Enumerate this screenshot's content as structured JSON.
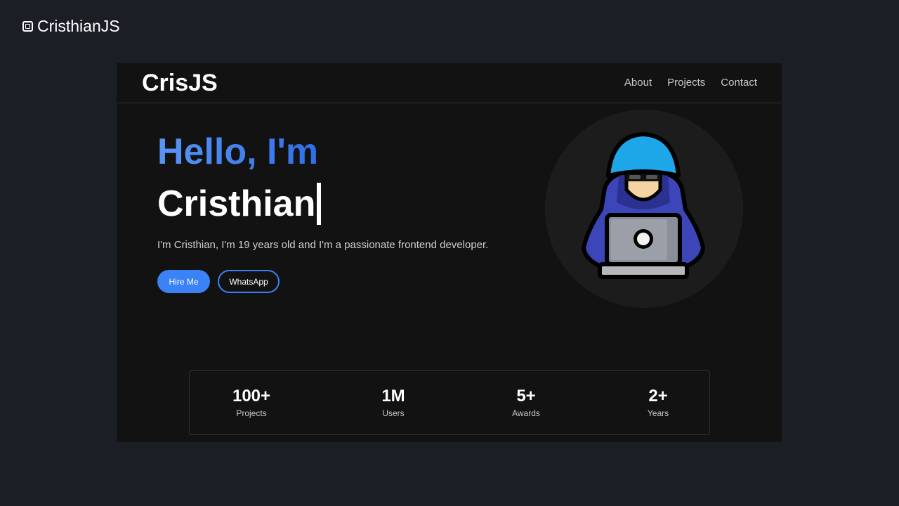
{
  "window": {
    "title": "CristhianJS",
    "icon": "app-logo-icon"
  },
  "nav": {
    "logo": "CrisJS",
    "links": [
      "About",
      "Projects",
      "Contact"
    ]
  },
  "hero": {
    "greeting": "Hello, I'm",
    "name": "Cristhian",
    "description": "I'm Cristhian, I'm 19 years old and I'm a passionate frontend developer.",
    "hire_button": "Hire Me",
    "whatsapp_button": "WhatsApp",
    "avatar_icon": "hooded-hacker-laptop-icon"
  },
  "stats": [
    {
      "value": "100+",
      "label": "Projects"
    },
    {
      "value": "1M",
      "label": "Users"
    },
    {
      "value": "5+",
      "label": "Awards"
    },
    {
      "value": "2+",
      "label": "Years"
    }
  ],
  "colors": {
    "background": "#1c1e26",
    "frame": "#121212",
    "accent": "#3b82f6",
    "text": "#ffffff"
  }
}
